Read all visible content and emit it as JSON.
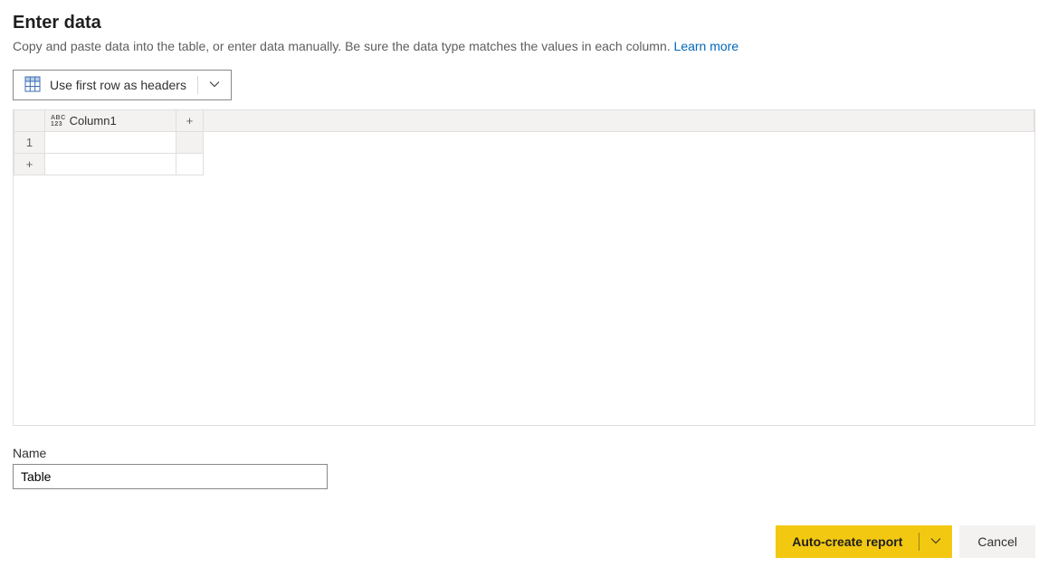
{
  "header": {
    "title": "Enter data",
    "description": "Copy and paste data into the table, or enter data manually. Be sure the data type matches the values in each column. ",
    "learn_more": "Learn more"
  },
  "toolbar": {
    "use_first_row_label": "Use first row as headers"
  },
  "grid": {
    "type_top": "ABC",
    "type_bottom": "123",
    "columns": [
      "Column1"
    ],
    "row_numbers": [
      "1"
    ],
    "add_symbol": "+"
  },
  "name_field": {
    "label": "Name",
    "value": "Table"
  },
  "footer": {
    "primary_label": "Auto-create report",
    "cancel_label": "Cancel"
  }
}
